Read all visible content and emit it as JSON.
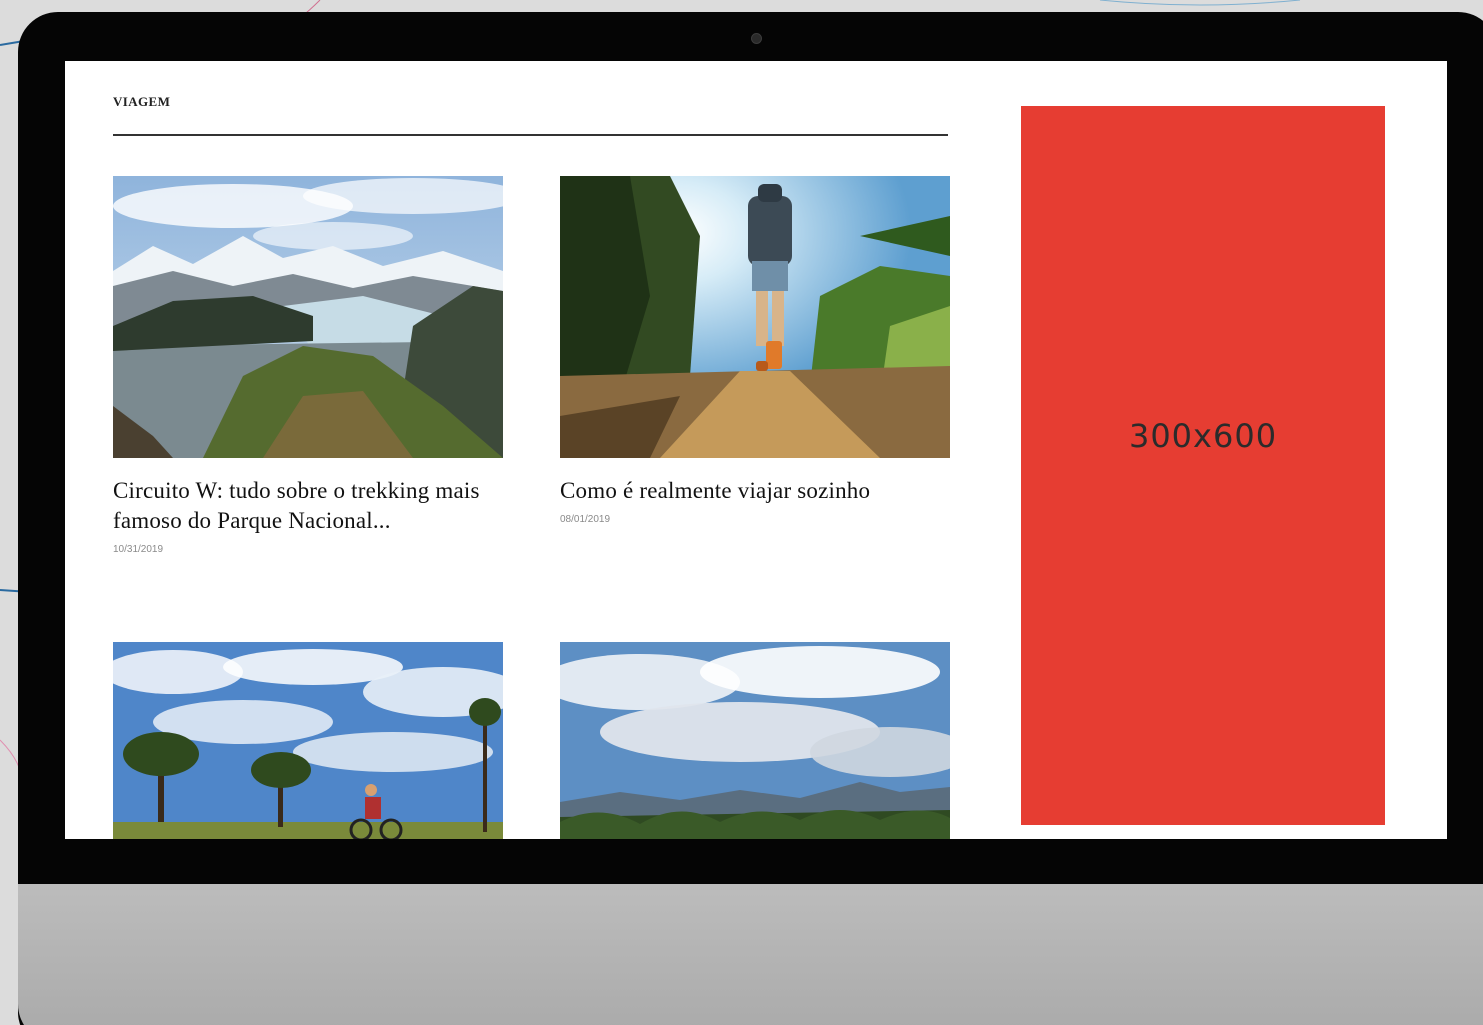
{
  "section": {
    "title": "VIAGEM"
  },
  "articles": [
    {
      "title": "Circuito W: tudo sobre o trekking mais famoso do Parque Nacional...",
      "date": "10/31/2019",
      "image": "glacier-lake-mountains-photo"
    },
    {
      "title": "Como é realmente viajar sozinho",
      "date": "08/01/2019",
      "image": "backpacker-trail-photo"
    },
    {
      "title": "",
      "date": "",
      "image": "cyclist-trees-sky-photo"
    },
    {
      "title": "",
      "date": "",
      "image": "clouds-mountains-forest-photo"
    }
  ],
  "ad": {
    "label": "300x600",
    "color": "#e63d32"
  },
  "colors": {
    "bezel": "#050505",
    "chin": "#b4b4b4",
    "screen": "#ffffff",
    "accent": "#e63d32"
  }
}
